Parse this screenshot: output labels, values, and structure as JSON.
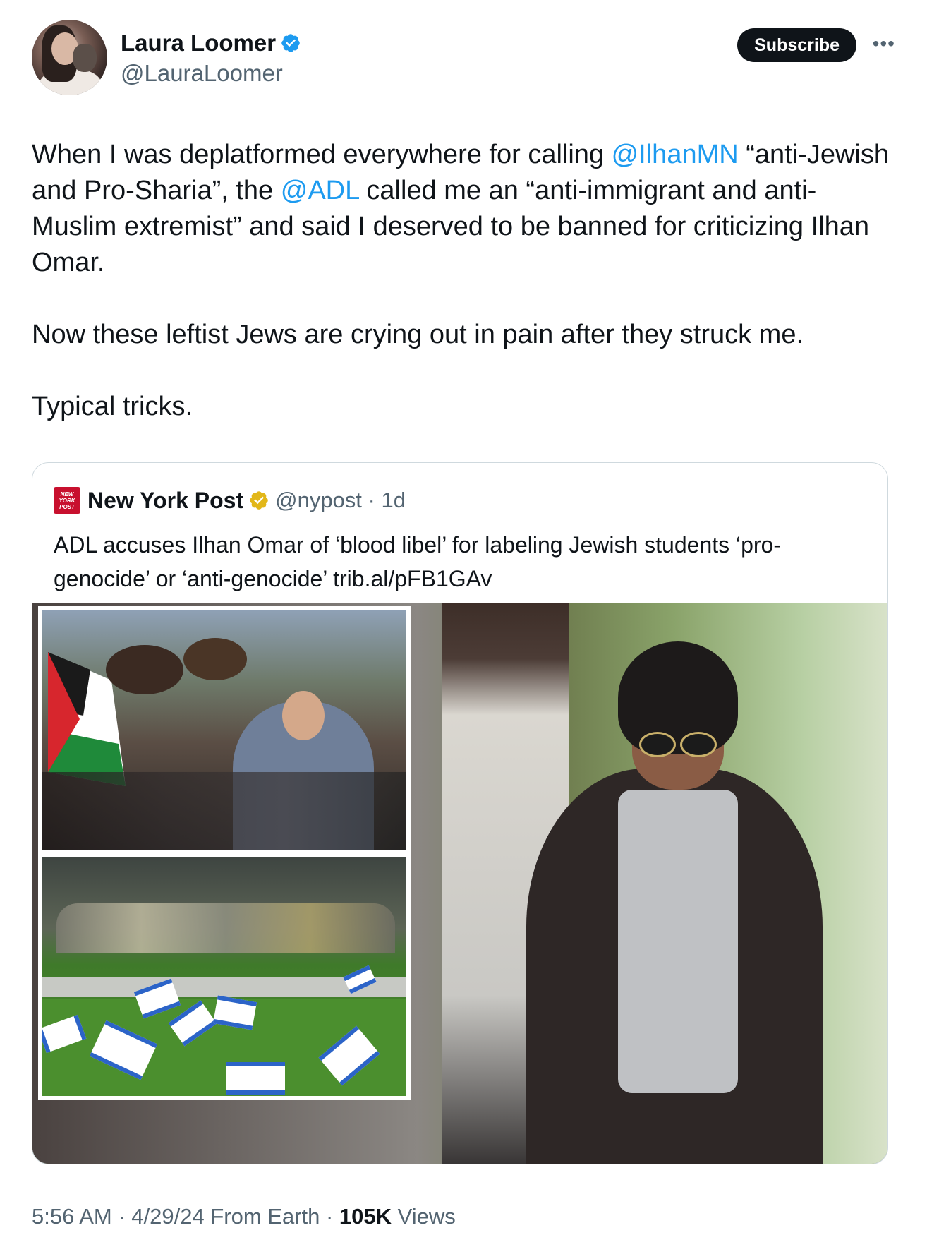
{
  "author": {
    "display_name": "Laura Loomer",
    "handle": "@LauraLoomer",
    "verified_badge_color": "#1d9bf0"
  },
  "header": {
    "subscribe_label": "Subscribe",
    "more_icon": "more-horizontal-icon"
  },
  "tweet": {
    "p1_a": "When I was deplatformed everywhere for calling ",
    "p1_mention1": "@IlhanMN",
    "p1_b": " “anti-Jewish and Pro-Sharia”, the ",
    "p1_mention2": "@ADL",
    "p1_c": " called me an “anti-immigrant and anti-Muslim extremist” and said I deserved to be banned for criticizing Ilhan Omar.",
    "p2": "Now these leftist Jews are crying out in pain after they struck me.",
    "p3": "Typical tricks."
  },
  "quote": {
    "logo_text": "NEW YORK POST",
    "name": "New York Post",
    "badge_color": "#e2b719",
    "handle_time": "@nypost · 1d",
    "text": "ADL accuses Ilhan Omar of ‘blood libel’ for labeling Jewish students ‘pro-genocide’ or ‘anti-genocide’ trib.al/pFB1GAv"
  },
  "meta": {
    "time_date": "5:56 AM · 4/29/24 From Earth · ",
    "views_count": "105K",
    "views_label": " Views"
  },
  "colors": {
    "accent": "#1d9bf0",
    "text_primary": "#0f1419",
    "text_secondary": "#536471",
    "nypost_red": "#c8102e"
  }
}
